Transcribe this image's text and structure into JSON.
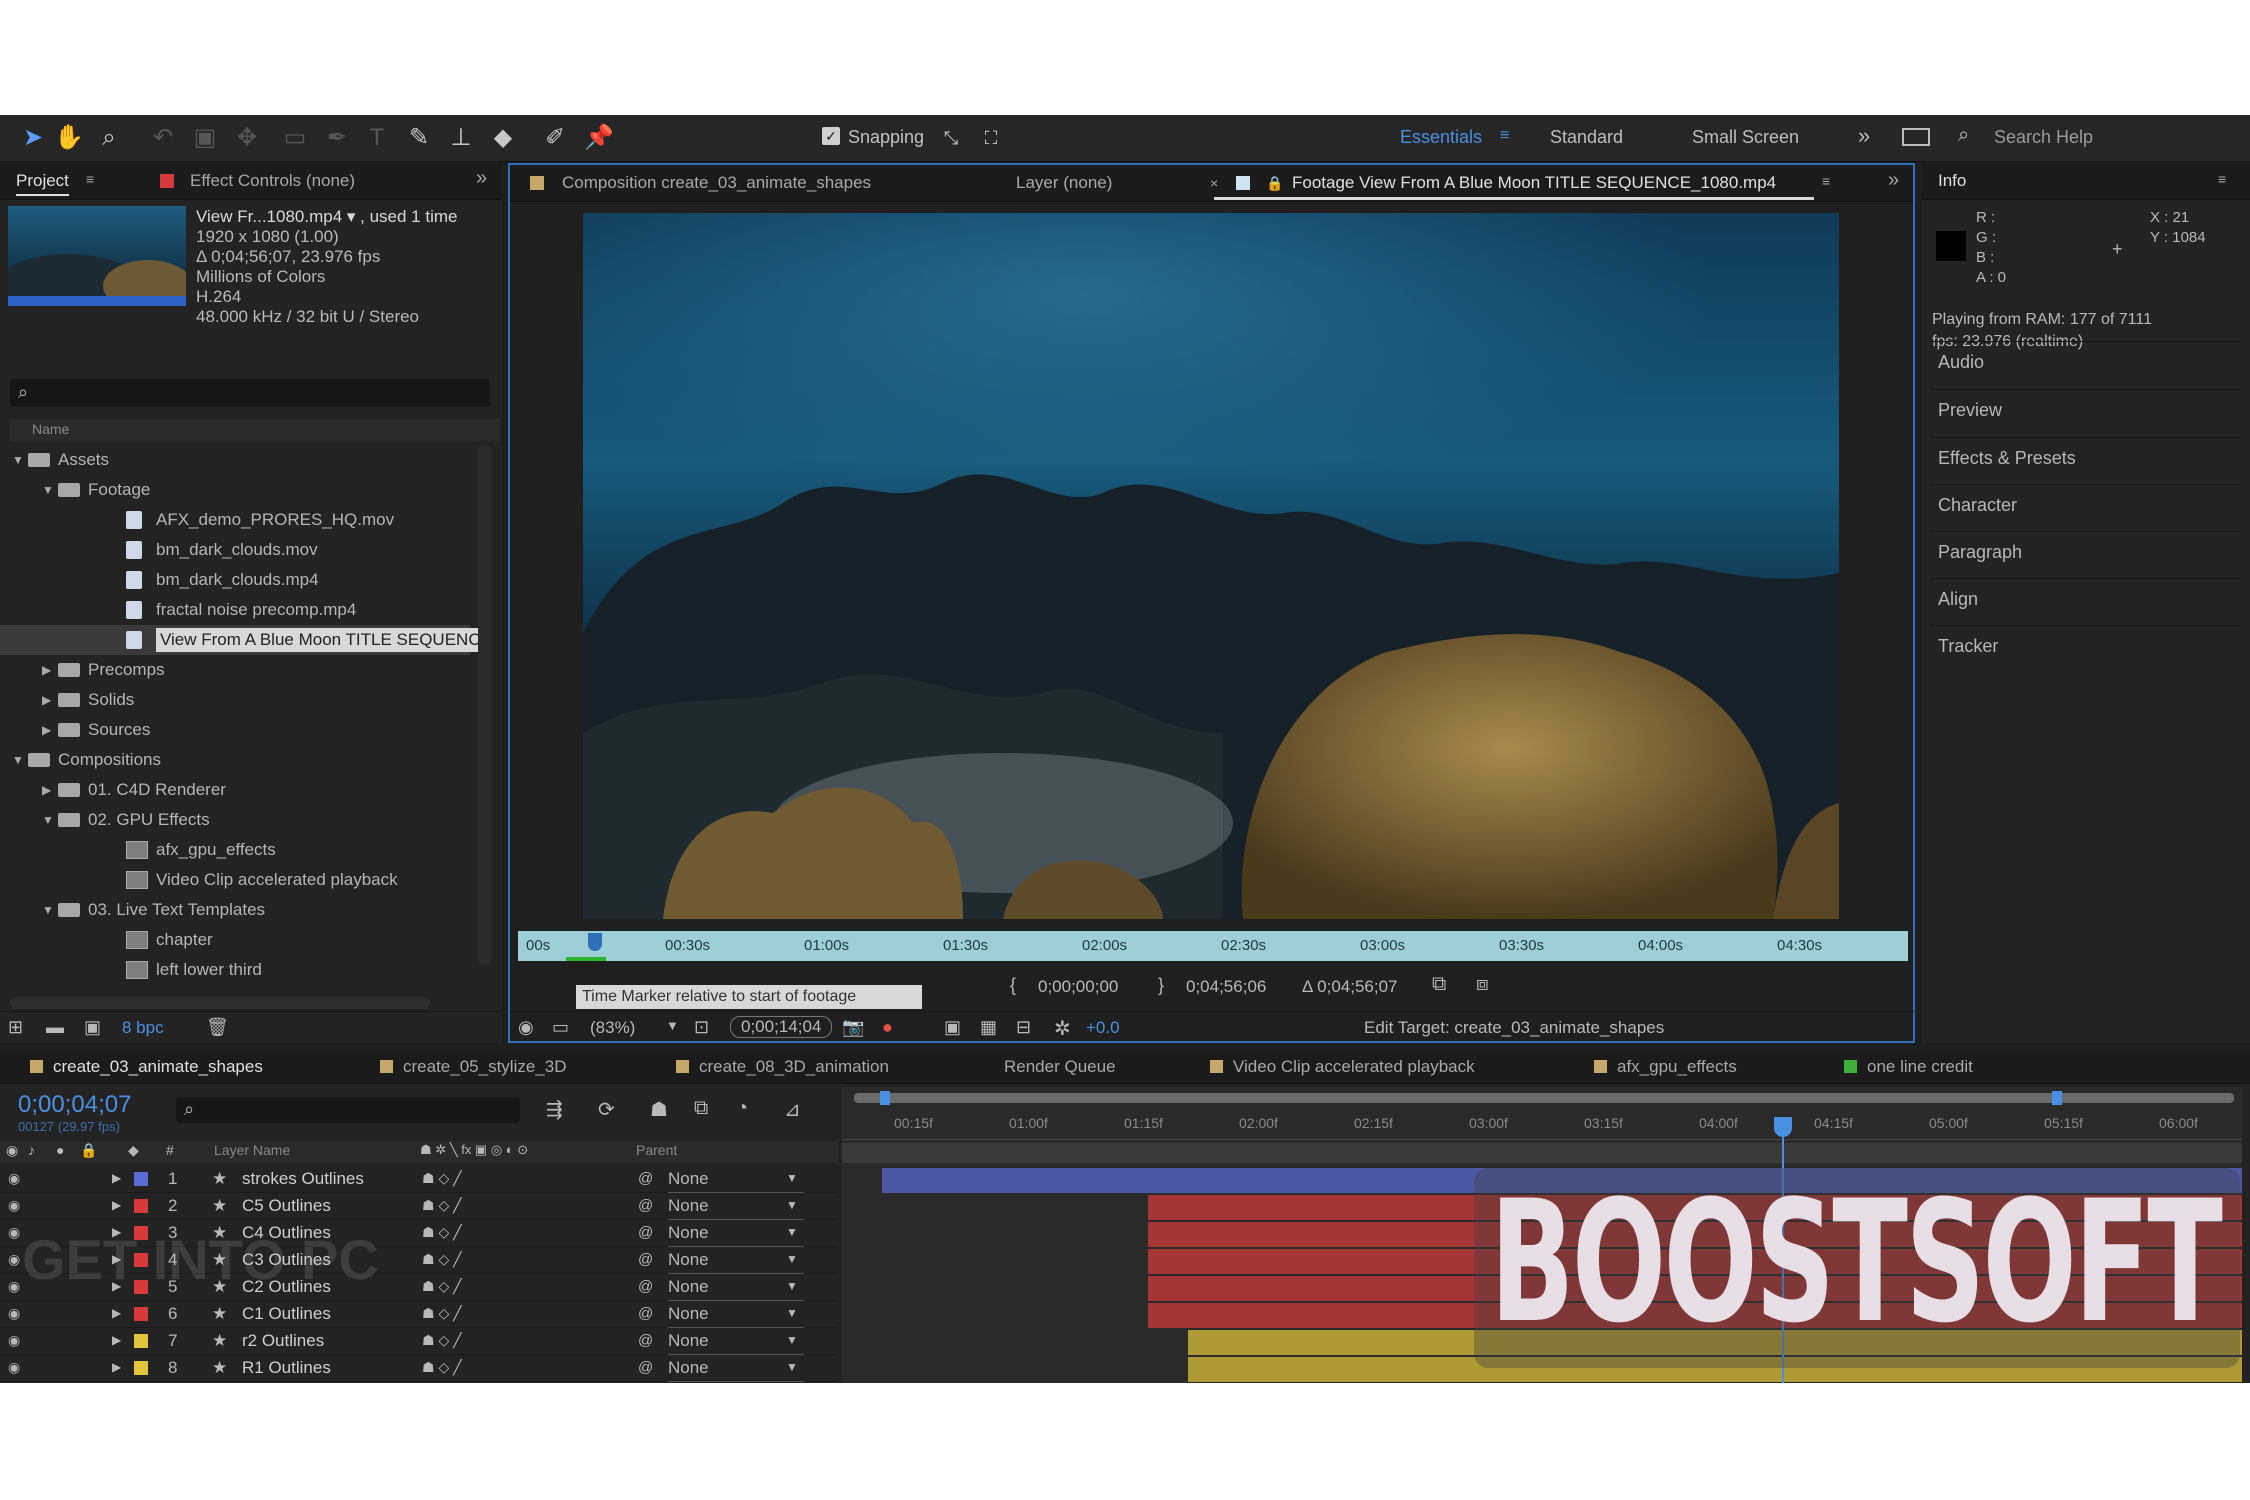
{
  "toolbar": {
    "snapping_label": "Snapping",
    "workspaces": [
      "Essentials",
      "Standard",
      "Small Screen"
    ],
    "active_workspace": "Essentials",
    "more_icon": "»",
    "search_placeholder": "Search Help"
  },
  "project_panel": {
    "tab_project": "Project",
    "tab_effect_controls": "Effect Controls (none)",
    "preview": {
      "name": "View Fr...1080.mp4 ▾ , used 1 time",
      "line1": "1920 x 1080 (1.00)",
      "line2": "Δ 0;04;56;07, 23.976 fps",
      "line3": "Millions of Colors",
      "line4": "H.264",
      "line5": "48.000 kHz / 32 bit U / Stereo"
    },
    "column_name": "Name",
    "tree": [
      {
        "label": "Assets",
        "depth": 0,
        "kind": "folder",
        "twisty": "▼"
      },
      {
        "label": "Footage",
        "depth": 1,
        "kind": "folder",
        "twisty": "▼"
      },
      {
        "label": "AFX_demo_PRORES_HQ.mov",
        "depth": 2,
        "kind": "file"
      },
      {
        "label": "bm_dark_clouds.mov",
        "depth": 2,
        "kind": "file"
      },
      {
        "label": "bm_dark_clouds.mp4",
        "depth": 2,
        "kind": "file"
      },
      {
        "label": "fractal noise precomp.mp4",
        "depth": 2,
        "kind": "file"
      },
      {
        "label": "View From A Blue Moon TITLE SEQUENC",
        "depth": 2,
        "kind": "file",
        "selected": true
      },
      {
        "label": "Precomps",
        "depth": 1,
        "kind": "folder",
        "twisty": "▶"
      },
      {
        "label": "Solids",
        "depth": 1,
        "kind": "folder",
        "twisty": "▶"
      },
      {
        "label": "Sources",
        "depth": 1,
        "kind": "folder",
        "twisty": "▶"
      },
      {
        "label": "Compositions",
        "depth": 0,
        "kind": "folder",
        "twisty": "▼"
      },
      {
        "label": "01. C4D Renderer",
        "depth": 1,
        "kind": "folder",
        "twisty": "▶"
      },
      {
        "label": "02. GPU Effects",
        "depth": 1,
        "kind": "folder",
        "twisty": "▼"
      },
      {
        "label": "afx_gpu_effects",
        "depth": 2,
        "kind": "comp"
      },
      {
        "label": "Video Clip accelerated playback",
        "depth": 2,
        "kind": "comp"
      },
      {
        "label": "03. Live Text Templates",
        "depth": 1,
        "kind": "folder",
        "twisty": "▼"
      },
      {
        "label": "chapter",
        "depth": 2,
        "kind": "comp"
      },
      {
        "label": "left lower third",
        "depth": 2,
        "kind": "comp"
      }
    ],
    "bpc": "8 bpc"
  },
  "viewer": {
    "tab_composition": "Composition create_03_animate_shapes",
    "tab_layer": "Layer (none)",
    "tab_footage": "Footage View From A Blue Moon TITLE SEQUENCE_1080.mp4",
    "ruler_labels": [
      "00s",
      "00:30s",
      "01:00s",
      "01:30s",
      "02:00s",
      "02:30s",
      "03:00s",
      "03:30s",
      "04:00s",
      "04:30s"
    ],
    "tooltip": "Time Marker relative to start of footage",
    "in_time": "0;00;00;00",
    "out_time": "0;04;56;06",
    "duration": "Δ 0;04;56;07",
    "zoom": "(83%)",
    "current_time": "0;00;14;04",
    "exposure": "+0.0",
    "edit_target": "Edit Target: create_03_animate_shapes"
  },
  "info_panel": {
    "title": "Info",
    "r": "R :",
    "g": "G :",
    "b": "B :",
    "a": "A : 0",
    "x": "X : 21",
    "y": "Y : 1084",
    "playing": "Playing from RAM: 177 of 7111",
    "fps": "fps: 23.976 (realtime)",
    "sections": [
      "Audio",
      "Preview",
      "Effects & Presets",
      "Character",
      "Paragraph",
      "Align",
      "Tracker"
    ]
  },
  "timeline": {
    "tabs": [
      {
        "label": "create_03_animate_shapes",
        "color": "#c7a86b"
      },
      {
        "label": "create_05_stylize_3D",
        "color": "#c7a86b"
      },
      {
        "label": "create_08_3D_animation",
        "color": "#c7a86b"
      },
      {
        "label": "Render Queue",
        "color": ""
      },
      {
        "label": "Video Clip accelerated playback",
        "color": "#c7a86b"
      },
      {
        "label": "afx_gpu_effects",
        "color": "#c7a86b"
      },
      {
        "label": "one line credit",
        "color": "#3fae3a"
      }
    ],
    "timecode": "0;00;04;07",
    "frame_info": "00127 (29.97 fps)",
    "col_layer_name": "Layer Name",
    "col_parent": "Parent",
    "ruler_labels": [
      "00:15f",
      "01:00f",
      "01:15f",
      "02:00f",
      "02:15f",
      "03:00f",
      "03:15f",
      "04:00f",
      "04:15f",
      "05:00f",
      "05:15f",
      "06:00f"
    ],
    "layers": [
      {
        "num": "1",
        "name": "strokes Outlines",
        "color": "#5b6bd6",
        "parent": "None"
      },
      {
        "num": "2",
        "name": "C5 Outlines",
        "color": "#d63a3a",
        "parent": "None"
      },
      {
        "num": "3",
        "name": "C4 Outlines",
        "color": "#d63a3a",
        "parent": "None"
      },
      {
        "num": "4",
        "name": "C3 Outlines",
        "color": "#d63a3a",
        "parent": "None"
      },
      {
        "num": "5",
        "name": "C2 Outlines",
        "color": "#d63a3a",
        "parent": "None"
      },
      {
        "num": "6",
        "name": "C1 Outlines",
        "color": "#d63a3a",
        "parent": "None"
      },
      {
        "num": "7",
        "name": "r2 Outlines",
        "color": "#e2c53a",
        "parent": "None"
      },
      {
        "num": "8",
        "name": "R1 Outlines",
        "color": "#e2c53a",
        "parent": "None"
      }
    ]
  },
  "watermarks": {
    "boostsoft": "BOOSTSOFT",
    "getintopc": "GET INTO PC"
  }
}
